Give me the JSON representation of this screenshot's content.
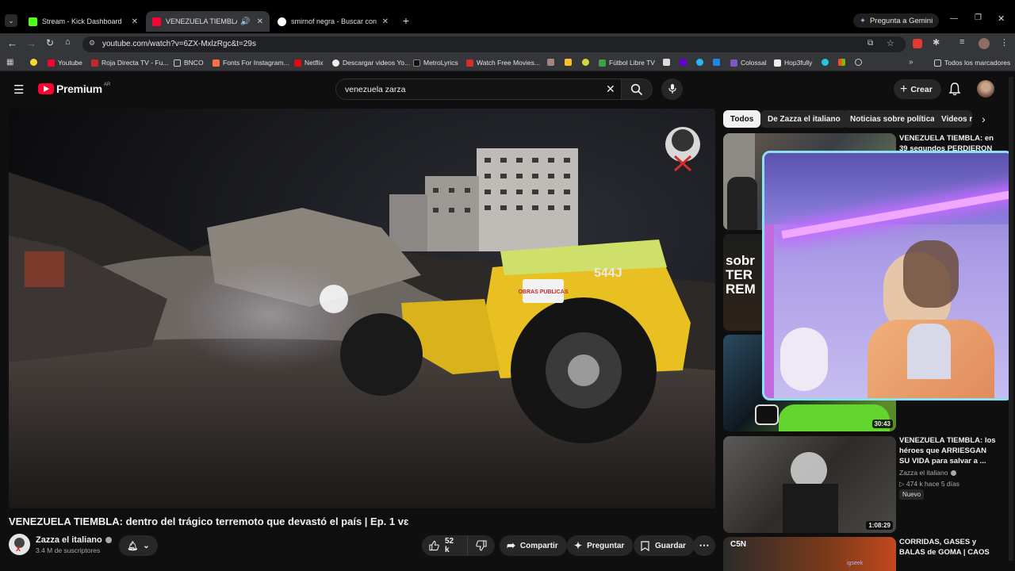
{
  "tabs": [
    {
      "title": "Stream - Kick Dashboard",
      "color": "#53fc18"
    },
    {
      "title": "VENEZUELA TIEMBLA: dentro",
      "color": "#ff0033"
    },
    {
      "title": "smirnof negra - Buscar con Goo",
      "color": "#4285f4"
    }
  ],
  "gemini_label": "Pregunta a Gemini",
  "url": "youtube.com/watch?v=6ZX-MxlzRgc&t=29s",
  "bookmarks": [
    "Youtube",
    "Roja Directa TV - Fu...",
    "BNCO",
    "Fonts For Instagram...",
    "Netflix",
    "Descargar videos Yo...",
    "MetroLyrics",
    "Watch Free Movies...",
    "Fútbol Libre TV",
    "Colossal",
    "Hop3fully",
    "Todos los marcadores"
  ],
  "yt": {
    "logo_text": "Premium",
    "logo_region": "AR",
    "search_value": "venezuela zarza",
    "create_label": "Crear",
    "chips": [
      "Todos",
      "De Zazza el italiano",
      "Noticias sobre política",
      "Videos re"
    ],
    "video_title": "VENEZUELA TIEMBLA: dentro del trágico terremoto que devastó el país | Ep. 1 vɛ",
    "channel_name": "Zazza el italiano",
    "subscribers": "3.4 M de suscriptores",
    "likes": "52 k",
    "share_label": "Compartir",
    "ask_label": "Preguntar",
    "save_label": "Guardar",
    "loader_text": "544J",
    "loader_sign": "OBRAS PUBLICAS"
  },
  "recommended": [
    {
      "title": "VENEZUELA TIEMBLA: en 39 segundos PERDIERON",
      "duration": ""
    },
    {
      "title": "",
      "duration": "",
      "overlay": "sobr TERREM"
    },
    {
      "title": "",
      "duration": "30:43"
    },
    {
      "title": "VENEZUELA TIEMBLA: los héroes que ARRIESGAN SU VIDA para salvar a ...",
      "channel": "Zazza el italiano",
      "stats": "▷ 474 k  hace 5 días",
      "badge": "Nuevo",
      "duration": "1:08:29"
    },
    {
      "title": "CORRIDAS, GASES y BALAS de GOMA | CAOS total en las",
      "overlay": "C5N",
      "duration": ""
    }
  ],
  "webcam_caption": "igseek"
}
